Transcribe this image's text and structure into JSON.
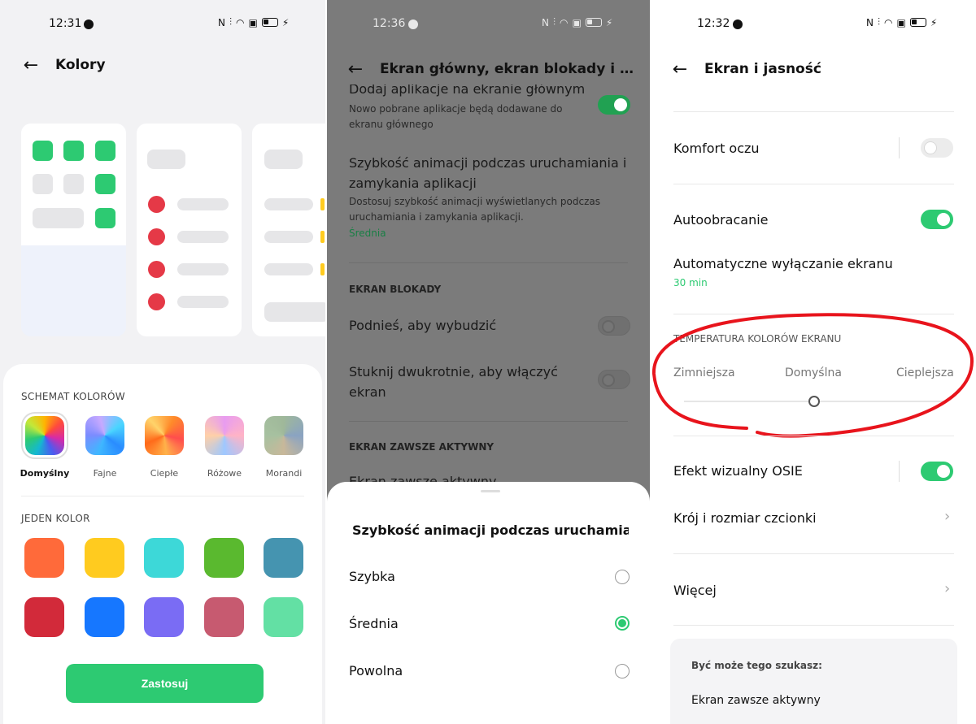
{
  "panel1": {
    "status": {
      "time": "12:31"
    },
    "header": {
      "title": "Kolory"
    },
    "section_scheme": "SCHEMAT KOLORÓW",
    "schemes": [
      {
        "label": "Domyślny",
        "selected": true
      },
      {
        "label": "Fajne"
      },
      {
        "label": "Ciepłe"
      },
      {
        "label": "Różowe"
      },
      {
        "label": "Morandi"
      }
    ],
    "section_single": "JEDEN KOLOR",
    "colors": [
      "#ff6a3a",
      "#ffcb1f",
      "#3dd8d8",
      "#5ab92f",
      "#4594b0",
      "#d22a3a",
      "#1677ff",
      "#7a6cf4",
      "#c75a70",
      "#63e0a4"
    ],
    "apply_label": "Zastosuj"
  },
  "panel2": {
    "status": {
      "time": "12:36"
    },
    "header": {
      "title": "Ekran główny, ekran blokady i ekran za..."
    },
    "add_apps_title": "Dodaj aplikacje na ekranie głównym",
    "add_apps_desc": "Nowo pobrane aplikacje będą dodawane do ekranu głównego",
    "anim_title": "Szybkość animacji podczas uruchamiania i zamykania aplikacji",
    "anim_desc": "Dostosuj szybkość animacji wyświetlanych podczas uruchamiania i zamykania aplikacji.",
    "anim_value": "Średnia",
    "lock_section": "EKRAN BLOKADY",
    "raise_to_wake": "Podnieś, aby wybudzić",
    "double_tap": "Stuknij dwukrotnie, aby włączyć ekran",
    "aod_section": "EKRAN ZAWSZE AKTYWNY",
    "aod_item": "Ekran zawsze aktywny",
    "sheet_title": "Szybkość animacji podczas uruchamian...",
    "options": [
      {
        "label": "Szybka",
        "selected": false
      },
      {
        "label": "Średnia",
        "selected": true
      },
      {
        "label": "Powolna",
        "selected": false
      }
    ]
  },
  "panel3": {
    "status": {
      "time": "12:32"
    },
    "header": {
      "title": "Ekran i jasność"
    },
    "eye_comfort": "Komfort oczu",
    "auto_rotate": "Autoobracanie",
    "auto_off": "Automatyczne wyłączanie ekranu",
    "auto_off_value": "30 min",
    "temp_section": "TEMPERATURA KOLORÓW EKRANU",
    "temp_labels": {
      "cool": "Zimniejsza",
      "default": "Domyślna",
      "warm": "Cieplejsza"
    },
    "temp_level": 0.5,
    "osie": "Efekt wizualny OSIE",
    "font": "Krój i rozmiar czcionki",
    "more": "Więcej",
    "suggest_title": "Być może tego szukasz:",
    "suggest_item": "Ekran zawsze aktywny"
  },
  "accent": "#2dca72",
  "annotation_color": "#e8141c"
}
